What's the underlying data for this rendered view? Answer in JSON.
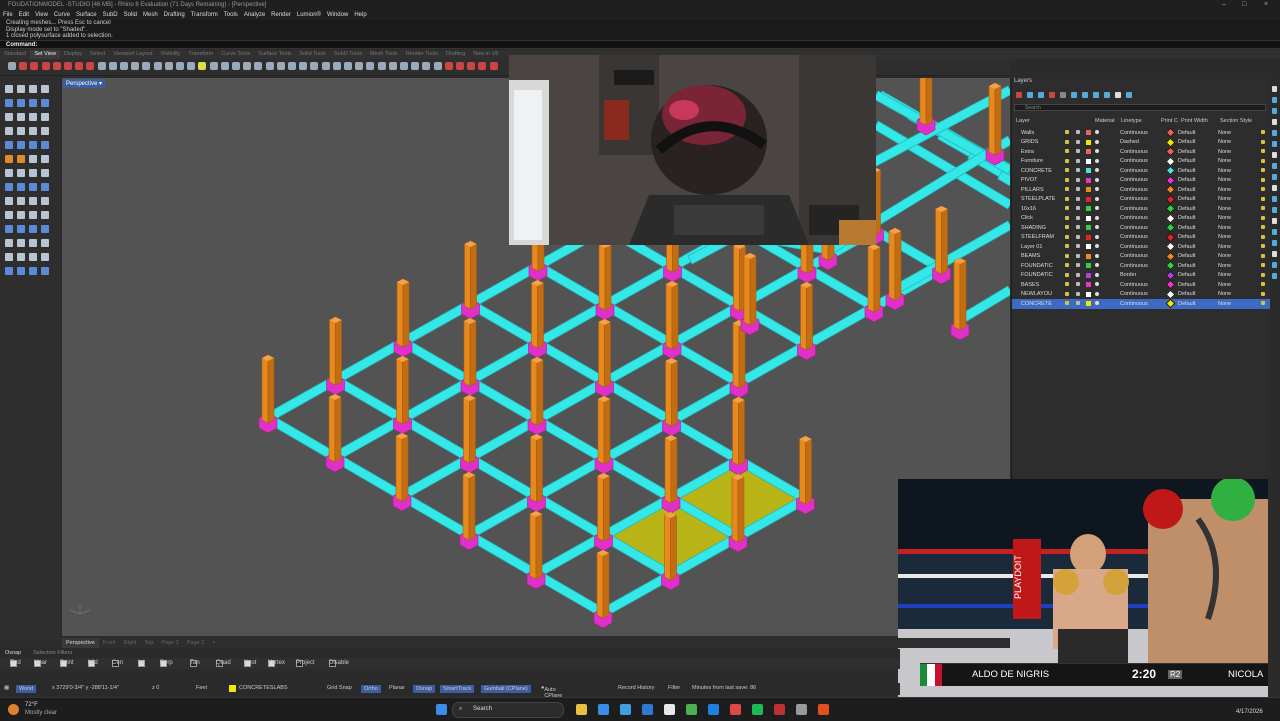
{
  "app": {
    "title": "FOUDATIONMODEL -STUDIO [46 MB] - Rhino 8 Evaluation (71 Days Remaining) - [Perspective]",
    "menu": [
      "File",
      "Edit",
      "View",
      "Curve",
      "Surface",
      "SubD",
      "Solid",
      "Mesh",
      "Drafting",
      "Transform",
      "Tools",
      "Analyze",
      "Render",
      "Lumion®",
      "Window",
      "Help"
    ]
  },
  "command_history": [
    "Creating meshes... Press Esc to cancel",
    "Display mode set to \"Shaded\".",
    "1 closed polysurface added to selection."
  ],
  "command_prompt": "Command:",
  "toolbar_tabs": [
    "Standard",
    "Set View",
    "Display",
    "Select",
    "Viewport Layout",
    "Visibility",
    "Transform",
    "Curve Tools",
    "Surface Tools",
    "Solid Tools",
    "SubD Tools",
    "Mesh Tools",
    "Render Tools",
    "Drafting",
    "New in V8"
  ],
  "toolbar_active_tab": "Set View",
  "viewport": {
    "label": "Perspective"
  },
  "layers_panel": {
    "title": "Layers",
    "search_placeholder": "Search",
    "columns": [
      "Layer",
      "Material",
      "Linetype",
      "Print C",
      "Print Width",
      "Section Style"
    ],
    "rows": [
      {
        "name": "Walls",
        "color": "#e8655e",
        "linetype": "Continuous",
        "print_width": "Default",
        "section": "None",
        "print_color": "#e8655e"
      },
      {
        "name": "GRIDS",
        "color": "#f2e600",
        "linetype": "Dashed",
        "print_width": "Default",
        "section": "None",
        "print_color": "#f2e600"
      },
      {
        "name": "Extra",
        "color": "#e8655e",
        "linetype": "Continuous",
        "print_width": "Default",
        "section": "None",
        "print_color": "#e8655e"
      },
      {
        "name": "Furniture",
        "color": "#ffffff",
        "linetype": "Continuous",
        "print_width": "Default",
        "section": "None",
        "print_color": "#ffffff"
      },
      {
        "name": "CONCRETE",
        "color": "#4ee0e0",
        "linetype": "Continuous",
        "print_width": "Default",
        "section": "None",
        "print_color": "#4ee0e0"
      },
      {
        "name": "PIVOT",
        "color": "#e836c8",
        "linetype": "Continuous",
        "print_width": "Default",
        "section": "None",
        "print_color": "#e836c8"
      },
      {
        "name": "PILLARS",
        "color": "#f08a1e",
        "linetype": "Continuous",
        "print_width": "Default",
        "section": "None",
        "print_color": "#f08a1e"
      },
      {
        "name": "STEELPLATE",
        "color": "#e02424",
        "linetype": "Continuous",
        "print_width": "Default",
        "section": "None",
        "print_color": "#e02424"
      },
      {
        "name": "16x16",
        "color": "#30d040",
        "linetype": "Continuous",
        "print_width": "Default",
        "section": "None",
        "print_color": "#30d040"
      },
      {
        "name": "Click",
        "color": "#ffffff",
        "linetype": "Continuous",
        "print_width": "Default",
        "section": "None",
        "print_color": "#ffffff"
      },
      {
        "name": "SHADING",
        "color": "#30d040",
        "linetype": "Continuous",
        "print_width": "Default",
        "section": "None",
        "print_color": "#30d040"
      },
      {
        "name": "STEELFRAM",
        "color": "#e02424",
        "linetype": "Continuous",
        "print_width": "Default",
        "section": "None",
        "print_color": "#e02424"
      },
      {
        "name": "Layer 01",
        "color": "#ffffff",
        "linetype": "Continuous",
        "print_width": "Default",
        "section": "None",
        "print_color": "#ffffff"
      },
      {
        "name": "BEAMS",
        "color": "#f08a1e",
        "linetype": "Continuous",
        "print_width": "Default",
        "section": "None",
        "print_color": "#f08a1e"
      },
      {
        "name": "FOUNDATIC",
        "color": "#30d040",
        "linetype": "Continuous",
        "print_width": "Default",
        "section": "None",
        "print_color": "#30d040"
      },
      {
        "name": "FOUNDATIC",
        "color": "#b040e0",
        "linetype": "Border",
        "print_width": "Default",
        "section": "None",
        "print_color": "#b040e0"
      },
      {
        "name": "BASES",
        "color": "#e836c8",
        "linetype": "Continuous",
        "print_width": "Default",
        "section": "None",
        "print_color": "#e836c8"
      },
      {
        "name": "NEWLAYOU",
        "color": "#ffffff",
        "linetype": "Continuous",
        "print_width": "Default",
        "section": "None",
        "print_color": "#ffffff"
      },
      {
        "name": "CONCRETE",
        "color": "#f2e600",
        "linetype": "Continuous",
        "print_width": "Default",
        "section": "None",
        "print_color": "#f2e600",
        "selected": true
      }
    ]
  },
  "viewport_tabs": [
    "Perspective",
    "Front",
    "Right",
    "Top",
    "Page 1",
    "Page 2",
    "+"
  ],
  "osnap_tabs": [
    "Osnap",
    "Selection Filters"
  ],
  "osnaps": [
    {
      "label": "End",
      "on": true
    },
    {
      "label": "Near",
      "on": true
    },
    {
      "label": "Point",
      "on": true
    },
    {
      "label": "Mid",
      "on": true
    },
    {
      "label": "Cen",
      "on": false
    },
    {
      "label": "Int",
      "on": true
    },
    {
      "label": "Perp",
      "on": true
    },
    {
      "label": "Tan",
      "on": false
    },
    {
      "label": "Quad",
      "on": false
    },
    {
      "label": "Knot",
      "on": true
    },
    {
      "label": "Vertex",
      "on": true
    },
    {
      "label": "Project",
      "on": false
    },
    {
      "label": "Disable",
      "on": false
    }
  ],
  "status": {
    "cplane": "World",
    "coords": "x 3729'0-3/4\"  y -288'11-1/4\"",
    "z": "z 0",
    "units": "Feet",
    "layer": "CONCRETESLABS",
    "layer_color": "#f2e600",
    "grid_snap": "Grid Snap",
    "ortho": "Ortho",
    "planar": "Planar",
    "osnap": "Osnap",
    "smarttrack": "SmartTrack",
    "gumball": "Gumball (CPlane)",
    "auto_cplane": "Auto CPlane (World)",
    "record_history": "Record History",
    "filter": "Filter",
    "autosave": "Minutes from last save: 86"
  },
  "boxing_overlay": {
    "fighter_left": "ALDO DE NIGRIS",
    "clock": "2:20",
    "fighter_right": "NICOLA",
    "round_badge": "R2"
  },
  "taskbar": {
    "weather_temp": "72°F",
    "weather_desc": "Mostly clear",
    "search_placeholder": "Search",
    "date": "4/17/2026"
  }
}
